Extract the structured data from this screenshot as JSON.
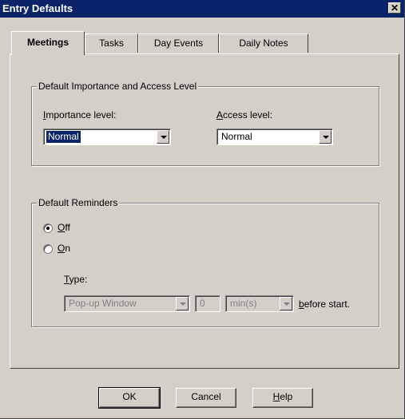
{
  "window": {
    "title": "Entry Defaults",
    "close_glyph": "✕"
  },
  "tabs": [
    {
      "label": "Meetings",
      "active": true
    },
    {
      "label": "Tasks",
      "active": false
    },
    {
      "label": "Day Events",
      "active": false
    },
    {
      "label": "Daily Notes",
      "active": false
    }
  ],
  "importance_group": {
    "legend": "Default Importance and Access Level",
    "importance_label_u": "I",
    "importance_label_rest": "mportance level:",
    "importance_value": "Normal",
    "access_label_u": "A",
    "access_label_rest": "ccess level:",
    "access_value": "Normal"
  },
  "reminders_group": {
    "legend": "Default Reminders",
    "off_label_u": "O",
    "off_label_rest": "ff",
    "on_label_u": "O",
    "on_label_rest": "n",
    "selected": "Off",
    "type_label_u": "T",
    "type_label_rest": "ype:",
    "type_value": "Pop-up Window",
    "amount_value": "0",
    "unit_value": "min(s)",
    "before_label_u": "b",
    "before_label_rest": "efore start."
  },
  "buttons": {
    "ok": "OK",
    "cancel": "Cancel",
    "help_u": "H",
    "help_rest": "elp"
  },
  "icons": {
    "close": "close-icon",
    "dropdown": "chevron-down-icon",
    "radio": "radio-button-icon"
  },
  "colors": {
    "titlebar": "#0a246a",
    "face": "#d4d0c8",
    "selection": "#0a246a"
  }
}
